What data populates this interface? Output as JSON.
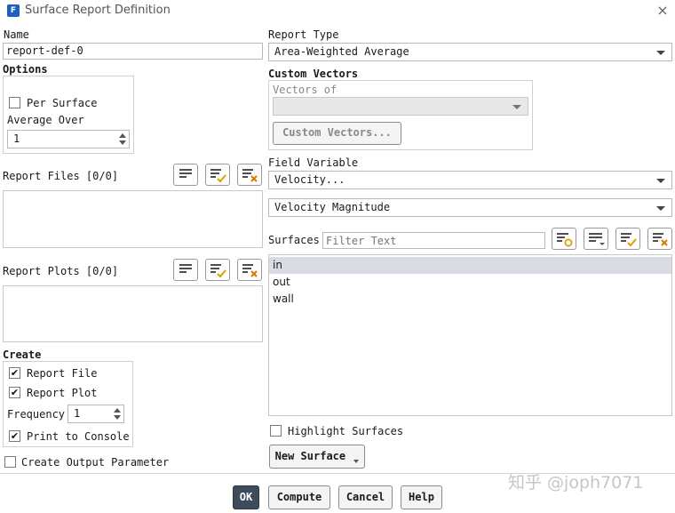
{
  "window": {
    "title": "Surface Report Definition",
    "app_icon_letter": "F",
    "close_glyph": "×"
  },
  "name": {
    "label": "Name",
    "value": "report-def-0"
  },
  "options": {
    "label": "Options",
    "per_surface_label": "Per Surface",
    "per_surface_checked": false,
    "average_over_label": "Average Over",
    "average_over_value": "1"
  },
  "report_files": {
    "label": "Report Files [0/0]"
  },
  "report_plots": {
    "label": "Report Plots [0/0]"
  },
  "create": {
    "label": "Create",
    "report_file_label": "Report File",
    "report_file_checked": true,
    "report_plot_label": "Report Plot",
    "report_plot_checked": true,
    "frequency_label": "Frequency",
    "frequency_value": "1",
    "print_console_label": "Print to Console",
    "print_console_checked": true
  },
  "create_output_parameter": {
    "label": "Create Output Parameter",
    "checked": false
  },
  "report_type": {
    "label": "Report Type",
    "value": "Area-Weighted Average"
  },
  "custom_vectors": {
    "label": "Custom Vectors",
    "vectors_of_label": "Vectors of",
    "vectors_of_value": "",
    "button_label": "Custom Vectors..."
  },
  "field_variable": {
    "label": "Field Variable",
    "category": "Velocity...",
    "value": "Velocity Magnitude"
  },
  "surfaces": {
    "label": "Surfaces",
    "filter_placeholder": "Filter Text",
    "items": [
      {
        "label": "in",
        "selected": true
      },
      {
        "label": "out",
        "selected": false
      },
      {
        "label": "wall",
        "selected": false
      }
    ],
    "highlight_label": "Highlight Surfaces",
    "highlight_checked": false,
    "new_surface_label": "New Surface"
  },
  "footer": {
    "ok": "OK",
    "compute": "Compute",
    "cancel": "Cancel",
    "help": "Help"
  },
  "check_glyph": "✔",
  "watermark": "知乎 @joph7071",
  "icons": {
    "list": "list-lines-icon",
    "select_all": "list-check-icon",
    "deselect_all": "list-x-icon",
    "filter_group": "list-circle-icon",
    "sort": "list-sort-icon"
  },
  "colors": {
    "ok_bg": "#3d4b5a",
    "check_accent": "#d9a200",
    "x_accent": "#d97a00",
    "circle_accent": "#d9a200",
    "selected_row": "#d9dde3"
  }
}
